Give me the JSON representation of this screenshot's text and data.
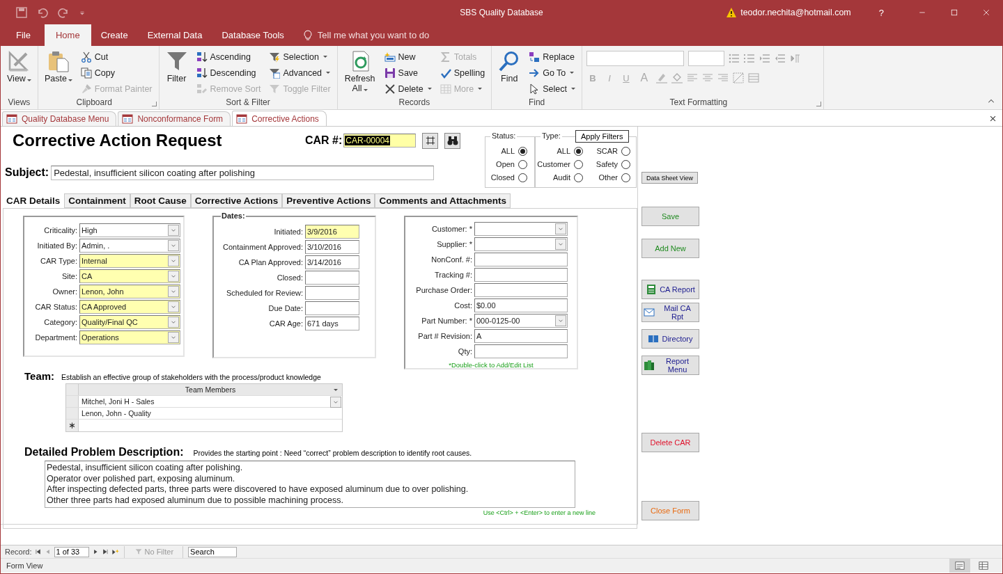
{
  "title_bar": {
    "title": "SBS Quality Database",
    "user": "teodor.nechita@hotmail.com",
    "help": "?"
  },
  "menu_tabs": [
    {
      "label": "File",
      "selected": false
    },
    {
      "label": "Home",
      "selected": true
    },
    {
      "label": "Create",
      "selected": false
    },
    {
      "label": "External Data",
      "selected": false
    },
    {
      "label": "Database Tools",
      "selected": false
    }
  ],
  "tell_me": "Tell me what you want to do",
  "ribbon_groups": [
    {
      "label": "Views",
      "launcher": false,
      "items": [
        {
          "label": "View",
          "kind": "large",
          "dropdown": true,
          "disabled": false
        }
      ]
    },
    {
      "label": "Clipboard",
      "launcher": true,
      "items": [
        {
          "label": "Paste",
          "kind": "large",
          "dropdown": true,
          "disabled": false
        },
        {
          "label": "Cut",
          "kind": "small",
          "dropdown": false,
          "disabled": false
        },
        {
          "label": "Copy",
          "kind": "small",
          "dropdown": false,
          "disabled": false
        },
        {
          "label": "Format Painter",
          "kind": "small",
          "dropdown": false,
          "disabled": true
        }
      ]
    },
    {
      "label": "Sort & Filter",
      "launcher": false,
      "items": [
        {
          "label": "Filter",
          "kind": "large",
          "dropdown": false,
          "disabled": false
        },
        {
          "label": "Ascending",
          "kind": "small",
          "dropdown": false,
          "disabled": false
        },
        {
          "label": "Descending",
          "kind": "small",
          "dropdown": false,
          "disabled": false
        },
        {
          "label": "Remove Sort",
          "kind": "small",
          "dropdown": false,
          "disabled": true
        },
        {
          "label": "Selection",
          "kind": "small",
          "dropdown": true,
          "disabled": false
        },
        {
          "label": "Advanced",
          "kind": "small",
          "dropdown": true,
          "disabled": false
        },
        {
          "label": "Toggle Filter",
          "kind": "small",
          "dropdown": false,
          "disabled": true
        }
      ]
    },
    {
      "label": "Records",
      "launcher": false,
      "items": [
        {
          "label": "Refresh All",
          "kind": "large",
          "dropdown": true,
          "disabled": false
        },
        {
          "label": "New",
          "kind": "small",
          "dropdown": false,
          "disabled": false
        },
        {
          "label": "Save",
          "kind": "small",
          "dropdown": false,
          "disabled": false
        },
        {
          "label": "Delete",
          "kind": "small",
          "dropdown": true,
          "disabled": false
        },
        {
          "label": "Totals",
          "kind": "small",
          "dropdown": false,
          "disabled": true
        },
        {
          "label": "Spelling",
          "kind": "small",
          "dropdown": false,
          "disabled": false
        },
        {
          "label": "More",
          "kind": "small",
          "dropdown": true,
          "disabled": true
        }
      ]
    },
    {
      "label": "Find",
      "launcher": false,
      "items": [
        {
          "label": "Find",
          "kind": "large",
          "dropdown": false,
          "disabled": false
        },
        {
          "label": "Replace",
          "kind": "small",
          "dropdown": false,
          "disabled": false
        },
        {
          "label": "Go To",
          "kind": "small",
          "dropdown": true,
          "disabled": false
        },
        {
          "label": "Select",
          "kind": "small",
          "dropdown": true,
          "disabled": false
        }
      ]
    }
  ],
  "text_formatting": {
    "label": "Text Formatting",
    "format_buttons": [
      "B",
      "I",
      "U"
    ],
    "font_color_button": "A"
  },
  "document_tabs": [
    {
      "label": "Quality Database Menu",
      "selected": false
    },
    {
      "label": "Nonconformance Form",
      "selected": false
    },
    {
      "label": "Corrective Actions",
      "selected": true
    }
  ],
  "form": {
    "title": "Corrective Action Request",
    "car_label": "CAR #:",
    "car_value": "CAR-00004",
    "subject_label": "Subject:",
    "subject_value": "Pedestal, insufficient silicon coating after polishing",
    "status_filter": {
      "label": "Status:",
      "options": [
        {
          "label": "ALL",
          "selected": true
        },
        {
          "label": "Open",
          "selected": false
        },
        {
          "label": "Closed",
          "selected": false
        }
      ]
    },
    "type_filter": {
      "label": "Type:",
      "options": [
        {
          "label": "ALL",
          "selected": true
        },
        {
          "label": "SCAR",
          "selected": false
        },
        {
          "label": "Customer",
          "selected": false
        },
        {
          "label": "Safety",
          "selected": false
        },
        {
          "label": "Audit",
          "selected": false
        },
        {
          "label": "Other",
          "selected": false
        }
      ]
    },
    "apply_filters": "Apply Filters",
    "tabs": [
      {
        "label": "CAR Details",
        "selected": true
      },
      {
        "label": "Containment",
        "selected": false
      },
      {
        "label": "Root Cause",
        "selected": false
      },
      {
        "label": "Corrective Actions",
        "selected": false
      },
      {
        "label": "Preventive Actions",
        "selected": false
      },
      {
        "label": "Comments and Attachments",
        "selected": false
      }
    ],
    "details_fields": [
      {
        "label": "Criticality:",
        "value": "High",
        "highlighted": false,
        "dropdown": true
      },
      {
        "label": "Initiated By:",
        "value": "Admin, .",
        "highlighted": false,
        "dropdown": true
      },
      {
        "label": "CAR Type:",
        "value": "Internal",
        "highlighted": true,
        "dropdown": true
      },
      {
        "label": "Site:",
        "value": "CA",
        "highlighted": true,
        "dropdown": true
      },
      {
        "label": "Owner:",
        "value": "Lenon, John",
        "highlighted": true,
        "dropdown": true
      },
      {
        "label": "CAR Status:",
        "value": "CA Approved",
        "highlighted": true,
        "dropdown": true
      },
      {
        "label": "Category:",
        "value": "Quality/Final QC",
        "highlighted": true,
        "dropdown": true
      },
      {
        "label": "Department:",
        "value": "Operations",
        "highlighted": true,
        "dropdown": true
      }
    ],
    "dates_label": "Dates:",
    "date_fields": [
      {
        "label": "Initiated:",
        "value": "3/9/2016",
        "highlighted": true,
        "dropdown": false
      },
      {
        "label": "Containment Approved:",
        "value": "3/10/2016",
        "highlighted": false,
        "dropdown": false
      },
      {
        "label": "CA Plan Approved:",
        "value": "3/14/2016",
        "highlighted": false,
        "dropdown": false
      },
      {
        "label": "Closed:",
        "highlighted": false,
        "dropdown": false
      },
      {
        "label": "Scheduled for Review:",
        "highlighted": false,
        "dropdown": false
      },
      {
        "label": "Due Date:",
        "highlighted": false,
        "dropdown": false
      },
      {
        "label": "CAR Age:",
        "value": "671 days",
        "highlighted": false,
        "dropdown": false
      }
    ],
    "source_fields": [
      {
        "label": "Customer: *",
        "highlighted": false,
        "dropdown": true
      },
      {
        "label": "Supplier: *",
        "highlighted": false,
        "dropdown": true
      },
      {
        "label": "NonConf. #:",
        "highlighted": false,
        "dropdown": false
      },
      {
        "label": "Tracking #:",
        "highlighted": false,
        "dropdown": false
      },
      {
        "label": "Purchase Order:",
        "highlighted": false,
        "dropdown": false
      },
      {
        "label": "Cost:",
        "value": "$0.00",
        "highlighted": false,
        "dropdown": false
      },
      {
        "label": "Part Number: *",
        "value": "000-0125-00",
        "highlighted": false,
        "dropdown": true
      },
      {
        "label": "Part # Revision:",
        "value": "A",
        "highlighted": false,
        "dropdown": false
      },
      {
        "label": "Qty:",
        "highlighted": false,
        "dropdown": false
      }
    ],
    "source_note": "*Double-click to Add/Edit List",
    "team_label": "Team:",
    "team_hint": "Establish an effective group of stakeholders with the process/product knowledge",
    "team_column": "Team Members",
    "team_rows": [
      {
        "value": "Mitchel, Joni H - Sales",
        "dropdown": true
      },
      {
        "value": "Lenon, John  - Quality",
        "dropdown": false
      }
    ],
    "description_label": "Detailed Problem Description:",
    "description_hint": "Provides the starting point : Need “correct” problem description to identify root causes.",
    "description_lines": [
      "Pedestal, insufficient silicon coating after polishing.",
      "Operator over polished part, exposing aluminum.",
      "After inspecting defected parts, three parts were discovered to have exposed aluminum due to over polishing.",
      "Other three parts had exposed aluminum due to possible machining process."
    ],
    "description_note": "Use <Ctrl> + <Enter> to enter a new line",
    "data_sheet_view": "Data Sheet View",
    "side_buttons": [
      {
        "label": "Save",
        "color": "#1f8a1f"
      },
      {
        "label": "Add New",
        "color": "#1f8a1f"
      },
      {
        "label": "CA Report",
        "color": "#1b1b8f"
      },
      {
        "label": "Mail CA Rpt",
        "color": "#1b1b8f"
      },
      {
        "label": "Directory",
        "color": "#1b1b8f"
      },
      {
        "label": "Report Menu",
        "color": "#1b1b8f"
      },
      {
        "label": "Delete CAR",
        "color": "#e0102a"
      },
      {
        "label": "Close Form",
        "color": "#e8690f"
      }
    ]
  },
  "record_nav": {
    "label": "Record:",
    "position": "1 of 33",
    "filter": "No Filter",
    "search_placeholder": "Search"
  },
  "status_bar": {
    "text": "Form View"
  }
}
